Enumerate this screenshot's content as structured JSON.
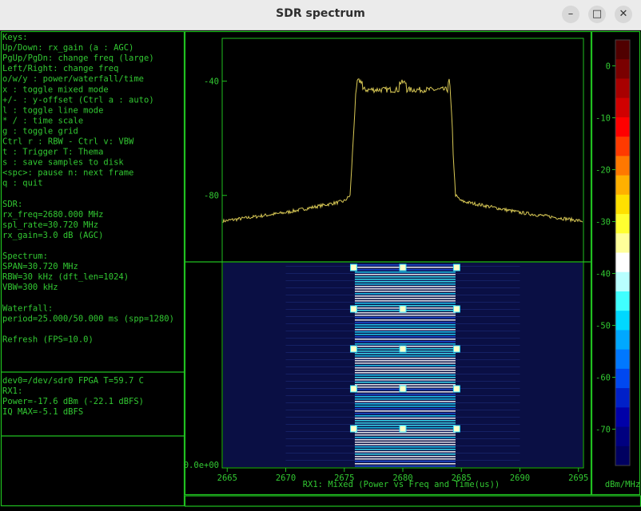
{
  "window": {
    "title": "SDR spectrum",
    "buttons": {
      "minimize": "–",
      "maximize": "□",
      "close": "✕"
    }
  },
  "help": {
    "lines": [
      "Keys:",
      "Up/Down: rx_gain (a : AGC)",
      "PgUp/PgDn: change freq (large)",
      "Left/Right: change freq",
      "o/w/y : power/waterfall/time",
      "x   : toggle mixed mode",
      "+/- : y-offset (Ctrl a : auto)",
      "l   : toggle line mode",
      "* / : time scale",
      "g   : toggle grid",
      "Ctrl r : RBW - Ctrl v: VBW",
      "t   : Trigger   T: Thema",
      "s   : save samples to disk",
      "<spc>: pause  n: next frame",
      "q   : quit",
      "",
      "SDR:",
      "rx_freq=2680.000 MHz",
      "spl_rate=30.720 MHz",
      "rx_gain=3.0 dB (AGC)",
      "",
      "Spectrum:",
      "SPAN=30.720 MHz",
      "RBW=30 kHz  (dft_len=1024)",
      "VBW=300 kHz",
      "",
      "Waterfall:",
      "period=25.000/50.000 ms (spp=1280)",
      "",
      "Refresh (FPS=10.0)"
    ]
  },
  "status": {
    "lines": [
      "dev0=/dev/sdr0  FPGA T=59.7 C",
      "RX1:",
      "  Power=-17.6 dBm (-22.1 dBFS)",
      "  IQ MAX=-5.1 dBFS"
    ]
  },
  "chart_data": [
    {
      "type": "line",
      "title": "",
      "xlabel": "RX1: Mixed (Power vs Freq and Time(us))",
      "ylabel": "",
      "xlim": [
        2664.64,
        2695.36
      ],
      "ylim": [
        -103,
        -25
      ],
      "x_ticks": [
        "2665",
        "2670",
        "2675",
        "2680",
        "2685",
        "2690",
        "2695"
      ],
      "y_ticks": [
        "-40",
        "-80"
      ],
      "y_tick_values": [
        -40,
        -80
      ],
      "series": [
        {
          "x": [
            2664.64,
            2670.0,
            2675.0,
            2675.5,
            2676.0,
            2680.0,
            2684.0,
            2684.5,
            2685.0,
            2690.0,
            2695.36
          ],
          "y": [
            -89,
            -86,
            -82,
            -80,
            -43,
            -43,
            -43,
            -80,
            -82,
            -86,
            -89
          ]
        }
      ],
      "line_color": "#d8c855"
    },
    {
      "type": "heatmap",
      "ylabel_tick": "0.0e+00",
      "band_mhz": [
        2675.9,
        2684.5
      ],
      "markers_mhz": [
        2675.8,
        2680.0,
        2684.6
      ]
    }
  ],
  "colorbar": {
    "label": "dBm/MHz",
    "ticks": [
      "0",
      "-10",
      "-20",
      "-30",
      "-40",
      "-50",
      "-60",
      "-70"
    ],
    "tick_values": [
      0,
      -10,
      -20,
      -30,
      -40,
      -50,
      -60,
      -70
    ],
    "range": [
      -77,
      5
    ],
    "colors": [
      "#500000",
      "#7a0000",
      "#a80000",
      "#d00000",
      "#ff0000",
      "#ff3a00",
      "#ff7800",
      "#ffb000",
      "#ffe000",
      "#ffff30",
      "#ffff9a",
      "#ffffff",
      "#b8ffff",
      "#40ffff",
      "#00d8ff",
      "#00a8ff",
      "#0078ff",
      "#0048f0",
      "#0020c8",
      "#0000a8",
      "#000080",
      "#000060"
    ]
  }
}
